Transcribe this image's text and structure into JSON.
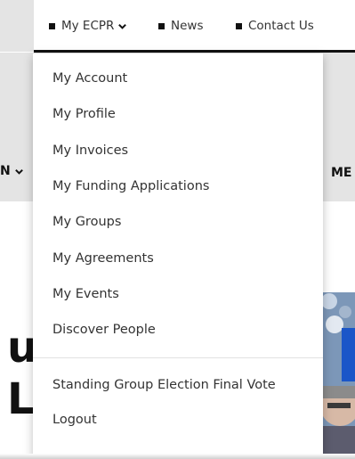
{
  "utility_nav": {
    "my_ecpr": "My ECPR",
    "news": "News",
    "contact_us": "Contact Us"
  },
  "main_nav": {
    "left_fragment": "N",
    "right_fragment": "ME"
  },
  "hero": {
    "line1_fragment": "u",
    "line2_fragment": "L"
  },
  "dropdown": {
    "items": [
      "My Account",
      "My Profile",
      "My Invoices",
      "My Funding Applications",
      "My Groups",
      "My Agreements",
      "My Events",
      "Discover People"
    ],
    "secondary_items": [
      "Standing Group Election Final Vote",
      "Logout"
    ]
  }
}
